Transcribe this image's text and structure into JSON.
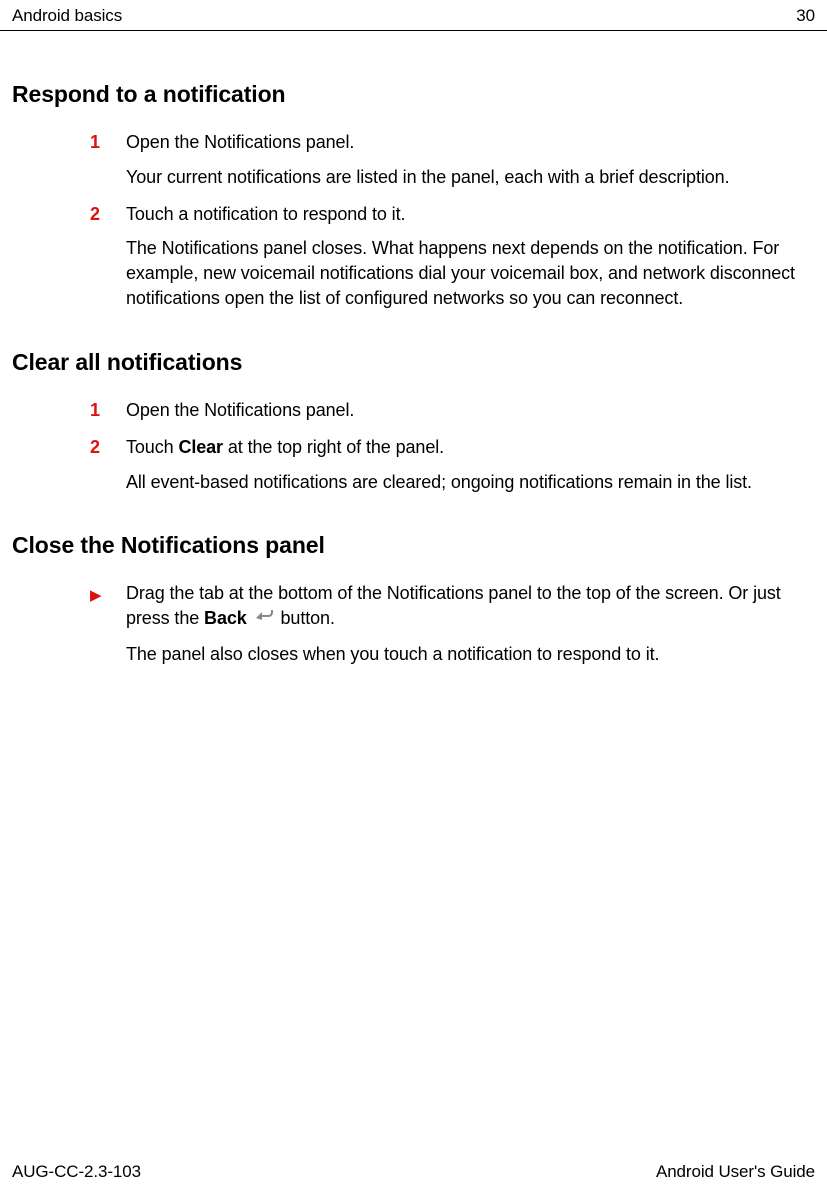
{
  "header": {
    "chapter": "Android basics",
    "page": "30"
  },
  "sections": [
    {
      "heading": "Respond to a notification",
      "steps": [
        {
          "num": "1",
          "text": "Open the Notifications panel.",
          "desc": "Your current notifications are listed in the panel, each with a brief description."
        },
        {
          "num": "2",
          "text": "Touch a notification to respond to it.",
          "desc": "The Notifications panel closes. What happens next depends on the notification. For example, new voicemail notifications dial your voicemail box, and network disconnect notifications open the list of configured networks so you can reconnect."
        }
      ]
    },
    {
      "heading": "Clear all notifications",
      "steps": [
        {
          "num": "1",
          "text": "Open the Notifications panel."
        },
        {
          "num": "2",
          "text_parts": {
            "pre": "Touch ",
            "bold": "Clear",
            "post": " at the top right of the panel."
          },
          "desc": "All event-based notifications are cleared; ongoing notifications remain in the list."
        }
      ]
    },
    {
      "heading": "Close the Notifications panel",
      "steps": [
        {
          "bullet": "▶",
          "text_parts": {
            "pre": "Drag the tab at the bottom of the Notifications panel to the top of the screen. Or just press the ",
            "bold": "Back",
            "post": " button."
          },
          "has_back_icon": true,
          "desc": "The panel also closes when you touch a notification to respond to it."
        }
      ]
    }
  ],
  "footer": {
    "doc_id": "AUG-CC-2.3-103",
    "guide": "Android User's Guide"
  }
}
